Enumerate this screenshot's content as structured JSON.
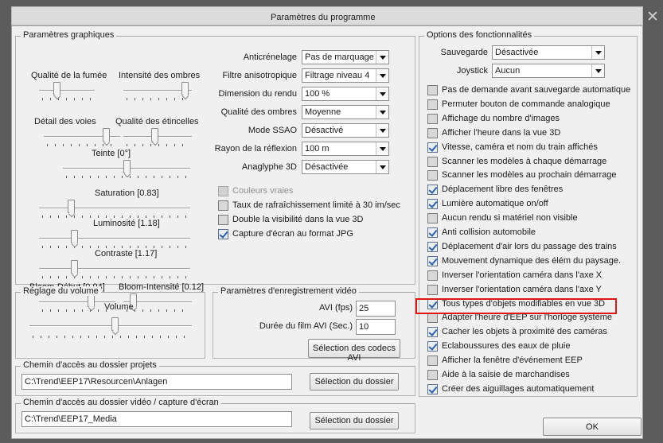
{
  "window": {
    "title": "Paramètres du programme",
    "close_glyph": "✕"
  },
  "graphics": {
    "legend": "Paramètres graphiques",
    "sliders": [
      {
        "label": "Qualité de la fumée",
        "value_ratio": 0.3
      },
      {
        "label": "Intensité des ombres",
        "value_ratio": 0.95
      },
      {
        "label": "Détail des voies",
        "value_ratio": 0.85
      },
      {
        "label": "Qualité des étincelles",
        "value_ratio": 0.45
      },
      {
        "label": "Teinte [0°]",
        "value_ratio": 0.5
      },
      {
        "label": "Saturation [0.83]",
        "value_ratio": 0.2
      },
      {
        "label": "Luminosité [1.18]",
        "value_ratio": 0.22
      },
      {
        "label": "Contraste [1.17]",
        "value_ratio": 0.22
      },
      {
        "label": "Bloom-Début [0.94]",
        "value_ratio": 0.7
      },
      {
        "label": "Bloom-Intensité [0.12]",
        "value_ratio": 0.1
      }
    ],
    "combos": [
      {
        "label": "Anticrénelage",
        "value": "Pas de marquage"
      },
      {
        "label": "Filtre anisotropique",
        "value": "Filtrage niveau 4"
      },
      {
        "label": "Dimension du rendu",
        "value": "100 %"
      },
      {
        "label": "Qualité des ombres",
        "value": "Moyenne"
      },
      {
        "label": "Mode SSAO",
        "value": "Désactivé"
      },
      {
        "label": "Rayon de la réflexion",
        "value": "100 m"
      },
      {
        "label": "Anaglyphe 3D",
        "value": "Désactivée"
      }
    ],
    "checkboxes": [
      {
        "label": "Couleurs vraies",
        "checked": false,
        "disabled": true
      },
      {
        "label": "Taux de rafraîchissement limité à 30 im/sec",
        "checked": false,
        "disabled": false
      },
      {
        "label": "Double la visibilité dans la vue 3D",
        "checked": false,
        "disabled": false
      },
      {
        "label": "Capture d'écran au format JPG",
        "checked": true,
        "disabled": false
      }
    ]
  },
  "volume": {
    "legend": "Réglage du volume",
    "label": "Volume",
    "value_ratio": 0.53
  },
  "video": {
    "legend": "Paramètres d'enregistrement vidéo",
    "fps_label": "AVI (fps)",
    "fps_value": "25",
    "duration_label": "Durée du film AVI (Sec.)",
    "duration_value": "10",
    "codec_button": "Sélection des codecs AVI"
  },
  "project_path": {
    "legend": "Chemin d'accès au dossier projets",
    "value": "C:\\Trend\\EEP17\\Resourcen\\Anlagen",
    "button": "Sélection du dossier"
  },
  "video_path": {
    "legend": "Chemin d'accès au dossier vidéo / capture d'écran",
    "value": "C:\\Trend\\EEP17_Media",
    "button": "Sélection du dossier"
  },
  "options": {
    "legend": "Options des fonctionnalités",
    "save_label": "Sauvegarde",
    "save_value": "Désactivée",
    "joystick_label": "Joystick",
    "joystick_value": "Aucun",
    "checkboxes": [
      {
        "label": "Pas de demande avant sauvegarde automatique",
        "checked": false
      },
      {
        "label": "Permuter bouton de commande analogique",
        "checked": false
      },
      {
        "label": "Affichage du nombre d'images",
        "checked": false
      },
      {
        "label": "Afficher l'heure dans la vue 3D",
        "checked": false
      },
      {
        "label": "Vitesse, caméra et nom du train affichés",
        "checked": true
      },
      {
        "label": "Scanner les modèles à chaque démarrage",
        "checked": false
      },
      {
        "label": "Scanner les modèles au prochain démarrage",
        "checked": false
      },
      {
        "label": "Déplacement libre des fenêtres",
        "checked": true
      },
      {
        "label": "Lumière automatique on/off",
        "checked": true
      },
      {
        "label": "Aucun rendu si matériel non visible",
        "checked": false
      },
      {
        "label": "Anti collision automobile",
        "checked": true
      },
      {
        "label": "Déplacement d'air lors du passage des trains",
        "checked": true
      },
      {
        "label": "Mouvement dynamique des élém du paysage.",
        "checked": true
      },
      {
        "label": "Inverser l'orientation caméra dans l'axe X",
        "checked": false
      },
      {
        "label": "Inverser l'orientation caméra dans l'axe Y",
        "checked": false
      },
      {
        "label": "Tous types d'objets modifiables en vue 3D",
        "checked": true
      },
      {
        "label": "Adapter l'heure d'EEP sur l'horloge système",
        "checked": false
      },
      {
        "label": "Cacher les objets à proximité des caméras",
        "checked": true
      },
      {
        "label": "Eclaboussures des eaux de pluie",
        "checked": true
      },
      {
        "label": "Afficher la fenêtre d'événement EEP",
        "checked": false
      },
      {
        "label": "Aide à la saisie de marchandises",
        "checked": false
      },
      {
        "label": "Créer des aiguillages automatiquement",
        "checked": true
      }
    ]
  },
  "ok_button": "OK",
  "colors": {
    "highlight": "#e01515",
    "check": "#2f5fa8"
  }
}
